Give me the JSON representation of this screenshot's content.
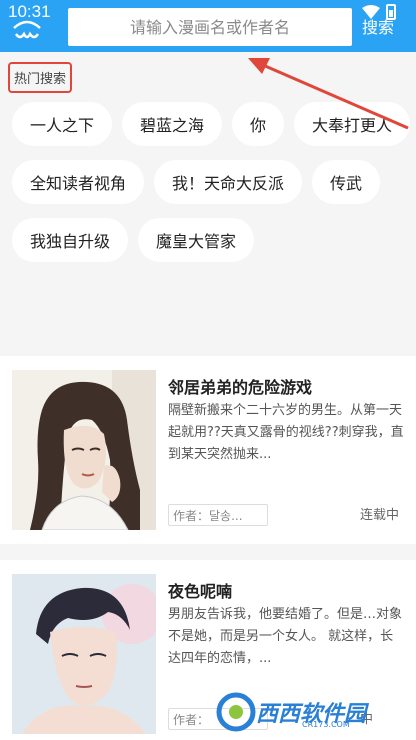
{
  "status_bar": {
    "time": "10:31"
  },
  "search": {
    "placeholder": "请输入漫画名或作者名",
    "value": "",
    "button_label": "搜索"
  },
  "hot_search": {
    "title": "热门搜索",
    "tags": [
      "一人之下",
      "碧蓝之海",
      "你",
      "大奉打更人",
      "全知读者视角",
      "我！天命大反派",
      "传武",
      "我独自升级",
      "魔皇大管家"
    ]
  },
  "comics": [
    {
      "title": "邻居弟弟的危险游戏",
      "description": "隔壁新搬来个二十六岁的男生。从第一天起就用??天真又露骨的视线??刺穿我，直到某天突然抛来...",
      "author": "作者：달송...",
      "status": "连载中"
    },
    {
      "title": "夜色呢喃",
      "description": "男朋友告诉我，他要结婚了。但是…对象不是她，而是另一个女人。 就这样，长达四年的恋情，...",
      "author": "作者：",
      "status": "中"
    }
  ],
  "watermark": {
    "text": "西西软件园",
    "sub": "CR173.COM"
  },
  "colors": {
    "primary": "#2aa3f5",
    "highlight_border": "#e0463a",
    "arrow": "#e0463a"
  }
}
